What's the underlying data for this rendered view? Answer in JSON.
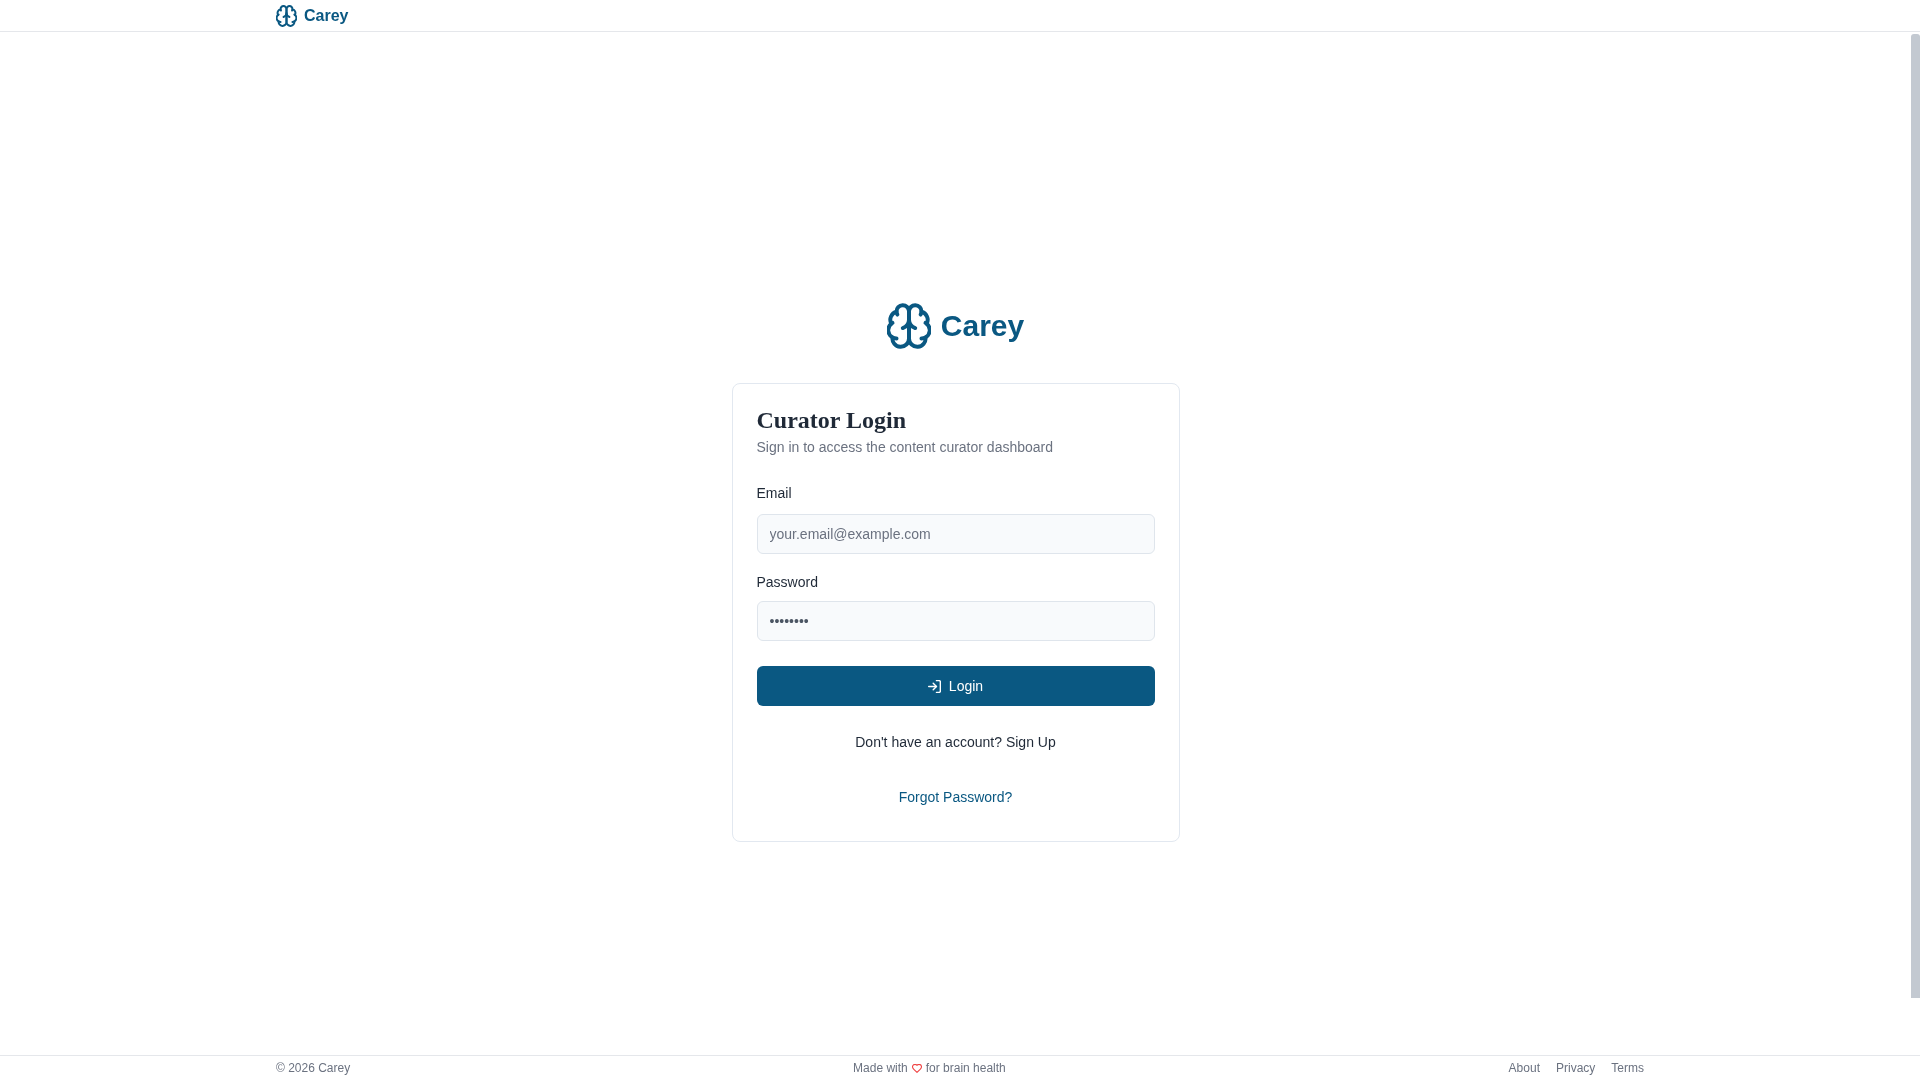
{
  "header": {
    "brand": "Carey"
  },
  "hero": {
    "brand": "Carey"
  },
  "login_card": {
    "title": "Curator Login",
    "subtitle": "Sign in to access the content curator dashboard",
    "fields": [
      {
        "label": "Email",
        "placeholder": "your.email@example.com"
      },
      {
        "label": "Password",
        "value": "••••••••"
      }
    ],
    "submit_button": "Login",
    "signup": {
      "prompt": "Don't have an account?",
      "link": "Sign Up"
    },
    "forgot_link": "Forgot Password?"
  },
  "footer": {
    "copyright": "© 2026 Carey",
    "tagline": {
      "before": "Made with",
      "after": "for brain health"
    },
    "links": [
      "About",
      "Privacy",
      "Terms"
    ]
  }
}
